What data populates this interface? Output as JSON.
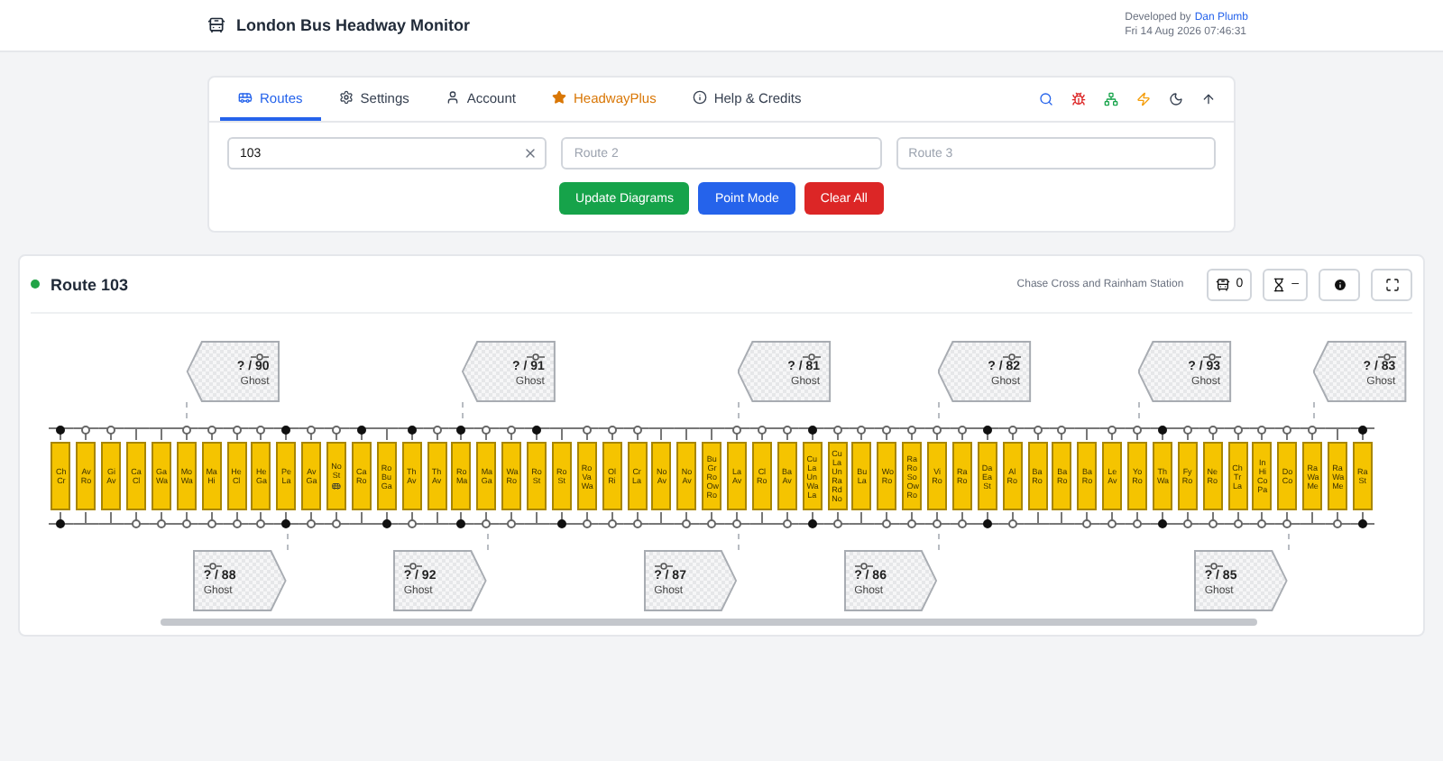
{
  "header": {
    "title": "London Bus Headway Monitor",
    "developed_by": "Developed by",
    "developer": "Dan Plumb",
    "timestamp": "Fri 14 Aug 2026 07:46:31"
  },
  "tabs": [
    {
      "label": "Routes",
      "selected": true,
      "highlighted": false
    },
    {
      "label": "Settings",
      "selected": false,
      "highlighted": false
    },
    {
      "label": "Account",
      "selected": false,
      "highlighted": false
    },
    {
      "label": "HeadwayPlus",
      "selected": false,
      "highlighted": true
    },
    {
      "label": "Help & Credits",
      "selected": false,
      "highlighted": false
    }
  ],
  "route_inputs": [
    {
      "value": "103"
    },
    {
      "placeholder": "Route 2"
    },
    {
      "placeholder": "Route 3"
    }
  ],
  "actions": [
    {
      "label": "Update Diagrams",
      "color": "#16a34a"
    },
    {
      "label": "Point Mode",
      "color": "#2563eb"
    },
    {
      "label": "Clear All",
      "color": "#dc2626"
    }
  ],
  "route": {
    "title": "Route 103",
    "status": {
      "color": "#22a447"
    },
    "destinations": "Chase Cross and Rainham Station",
    "bus_count": "0",
    "headway": "–",
    "stops": [
      {
        "name": "Ch Cr",
        "top": {
          "kind": "filled"
        },
        "bottom": {
          "kind": "filled"
        },
        "bus": false
      },
      {
        "name": "Av Ro",
        "top": {
          "kind": "hollow"
        },
        "bus": false
      },
      {
        "name": "Gi Av",
        "top": {
          "kind": "hollow"
        },
        "bus": false
      },
      {
        "name": "Ca Cl",
        "bottom": {
          "kind": "hollow"
        },
        "bus": false
      },
      {
        "name": "Ga Wa",
        "bottom": {
          "kind": "hollow"
        },
        "bus": false
      },
      {
        "name": "Mo Wa",
        "top": {
          "kind": "hollow"
        },
        "bottom": {
          "kind": "hollow"
        },
        "bus": false,
        "ghost_above": {
          "vehicle": "? / 90",
          "label": "Ghost"
        }
      },
      {
        "name": "Ma Hi",
        "top": {
          "kind": "hollow"
        },
        "bottom": {
          "kind": "hollow"
        },
        "bus": false
      },
      {
        "name": "He Cl",
        "top": {
          "kind": "hollow"
        },
        "bottom": {
          "kind": "hollow"
        },
        "bus": false
      },
      {
        "name": "He Ga",
        "top": {
          "kind": "hollow"
        },
        "bottom": {
          "kind": "hollow"
        },
        "bus": false
      },
      {
        "name": "Pe La",
        "top": {
          "kind": "filled"
        },
        "bottom": {
          "kind": "filled"
        },
        "bus": false,
        "ghost_below": {
          "vehicle": "? / 88",
          "label": "Ghost"
        }
      },
      {
        "name": "Av Ga",
        "top": {
          "kind": "hollow"
        },
        "bottom": {
          "kind": "hollow"
        },
        "bus": false
      },
      {
        "name": "No St",
        "top": {
          "kind": "hollow"
        },
        "bottom": {
          "kind": "hollow"
        },
        "bus": true
      },
      {
        "name": "Ca Ro",
        "top": {
          "kind": "filled"
        },
        "bus": false
      },
      {
        "name": "Ro Bu Ga",
        "bottom": {
          "kind": "filled"
        },
        "bus": false
      },
      {
        "name": "Th Av",
        "top": {
          "kind": "filled"
        },
        "bottom": {
          "kind": "hollow"
        },
        "bus": false
      },
      {
        "name": "Th Av",
        "top": {
          "kind": "hollow"
        },
        "bus": false
      },
      {
        "name": "Ro Ma",
        "top": {
          "kind": "filled"
        },
        "bottom": {
          "kind": "filled"
        },
        "bus": false,
        "ghost_above": {
          "vehicle": "? / 91",
          "label": "Ghost"
        }
      },
      {
        "name": "Ma Ga",
        "top": {
          "kind": "hollow"
        },
        "bottom": {
          "kind": "hollow"
        },
        "bus": false,
        "ghost_below": {
          "vehicle": "? / 92",
          "label": "Ghost"
        }
      },
      {
        "name": "Wa Ro",
        "top": {
          "kind": "hollow"
        },
        "bottom": {
          "kind": "hollow"
        },
        "bus": false
      },
      {
        "name": "Ro St",
        "top": {
          "kind": "filled"
        },
        "bus": false
      },
      {
        "name": "Ro St",
        "bottom": {
          "kind": "filled"
        },
        "bus": false
      },
      {
        "name": "Ro Va Wa",
        "top": {
          "kind": "hollow"
        },
        "bottom": {
          "kind": "hollow"
        },
        "bus": false
      },
      {
        "name": "Ol Ri",
        "top": {
          "kind": "hollow"
        },
        "bottom": {
          "kind": "hollow"
        },
        "bus": false
      },
      {
        "name": "Cr La",
        "top": {
          "kind": "hollow"
        },
        "bottom": {
          "kind": "hollow"
        },
        "bus": false
      },
      {
        "name": "No Av",
        "bus": false
      },
      {
        "name": "No Av",
        "bottom": {
          "kind": "hollow"
        },
        "bus": false
      },
      {
        "name": "Bu Gr Ro Ow Ro",
        "bottom": {
          "kind": "hollow"
        },
        "bus": false
      },
      {
        "name": "La Av",
        "top": {
          "kind": "hollow"
        },
        "bottom": {
          "kind": "hollow"
        },
        "bus": false,
        "ghost_above": {
          "vehicle": "? / 81",
          "label": "Ghost"
        },
        "ghost_below": {
          "vehicle": "? / 87",
          "label": "Ghost"
        }
      },
      {
        "name": "Cl Ro",
        "top": {
          "kind": "hollow"
        },
        "bus": false
      },
      {
        "name": "Ba Av",
        "top": {
          "kind": "hollow"
        },
        "bottom": {
          "kind": "hollow"
        },
        "bus": false
      },
      {
        "name": "Cu La Un Wa La",
        "top": {
          "kind": "filled"
        },
        "bottom": {
          "kind": "filled"
        },
        "bus": false
      },
      {
        "name": "Cu La Un Ra Rd No",
        "top": {
          "kind": "hollow"
        },
        "bottom": {
          "kind": "hollow"
        },
        "bus": false
      },
      {
        "name": "Bu La",
        "top": {
          "kind": "hollow"
        },
        "bus": false
      },
      {
        "name": "Wo Ro",
        "top": {
          "kind": "hollow"
        },
        "bottom": {
          "kind": "hollow"
        },
        "bus": false
      },
      {
        "name": "Ra Ro So Ow Ro",
        "top": {
          "kind": "hollow"
        },
        "bottom": {
          "kind": "hollow"
        },
        "bus": false
      },
      {
        "name": "Vi Ro",
        "top": {
          "kind": "hollow"
        },
        "bottom": {
          "kind": "hollow"
        },
        "bus": false,
        "ghost_above": {
          "vehicle": "? / 82",
          "label": "Ghost"
        },
        "ghost_below": {
          "vehicle": "? / 86",
          "label": "Ghost"
        }
      },
      {
        "name": "Ra Ro",
        "top": {
          "kind": "hollow"
        },
        "bottom": {
          "kind": "hollow"
        },
        "bus": false
      },
      {
        "name": "Da Ea St",
        "top": {
          "kind": "filled"
        },
        "bottom": {
          "kind": "filled"
        },
        "bus": false
      },
      {
        "name": "Al Ro",
        "top": {
          "kind": "hollow"
        },
        "bottom": {
          "kind": "hollow"
        },
        "bus": false
      },
      {
        "name": "Ba Ro",
        "top": {
          "kind": "hollow"
        },
        "bus": false
      },
      {
        "name": "Ba Ro",
        "top": {
          "kind": "hollow"
        },
        "bus": false
      },
      {
        "name": "Ba Ro",
        "bottom": {
          "kind": "hollow"
        },
        "bus": false
      },
      {
        "name": "Le Av",
        "top": {
          "kind": "hollow"
        },
        "bottom": {
          "kind": "hollow"
        },
        "bus": false
      },
      {
        "name": "Yo Ro",
        "top": {
          "kind": "hollow"
        },
        "bottom": {
          "kind": "hollow"
        },
        "bus": false,
        "ghost_above": {
          "vehicle": "? / 93",
          "label": "Ghost"
        }
      },
      {
        "name": "Th Wa",
        "top": {
          "kind": "filled"
        },
        "bottom": {
          "kind": "filled"
        },
        "bus": false
      },
      {
        "name": "Fy Ro",
        "top": {
          "kind": "hollow"
        },
        "bottom": {
          "kind": "hollow"
        },
        "bus": false
      },
      {
        "name": "Ne Ro",
        "top": {
          "kind": "hollow"
        },
        "bottom": {
          "kind": "hollow"
        },
        "bus": false
      },
      {
        "name": "Ch Tr La",
        "top": {
          "kind": "hollow"
        },
        "bottom": {
          "kind": "hollow"
        },
        "bus": false
      },
      {
        "name": "In Hi Co Pa",
        "top": {
          "kind": "hollow"
        },
        "bottom": {
          "kind": "hollow"
        },
        "bus": false
      },
      {
        "name": "Do Co",
        "top": {
          "kind": "hollow"
        },
        "bottom": {
          "kind": "hollow"
        },
        "bus": false,
        "ghost_below": {
          "vehicle": "? / 85",
          "label": "Ghost"
        }
      },
      {
        "name": "Ra Wa Me",
        "top": {
          "kind": "hollow"
        },
        "bus": false,
        "ghost_above": {
          "vehicle": "? / 83",
          "label": "Ghost"
        }
      },
      {
        "name": "Ra Wa Me",
        "bottom": {
          "kind": "hollow"
        },
        "bus": false
      },
      {
        "name": "Ra St",
        "top": {
          "kind": "filled"
        },
        "bottom": {
          "kind": "filled"
        },
        "bus": false
      }
    ]
  }
}
